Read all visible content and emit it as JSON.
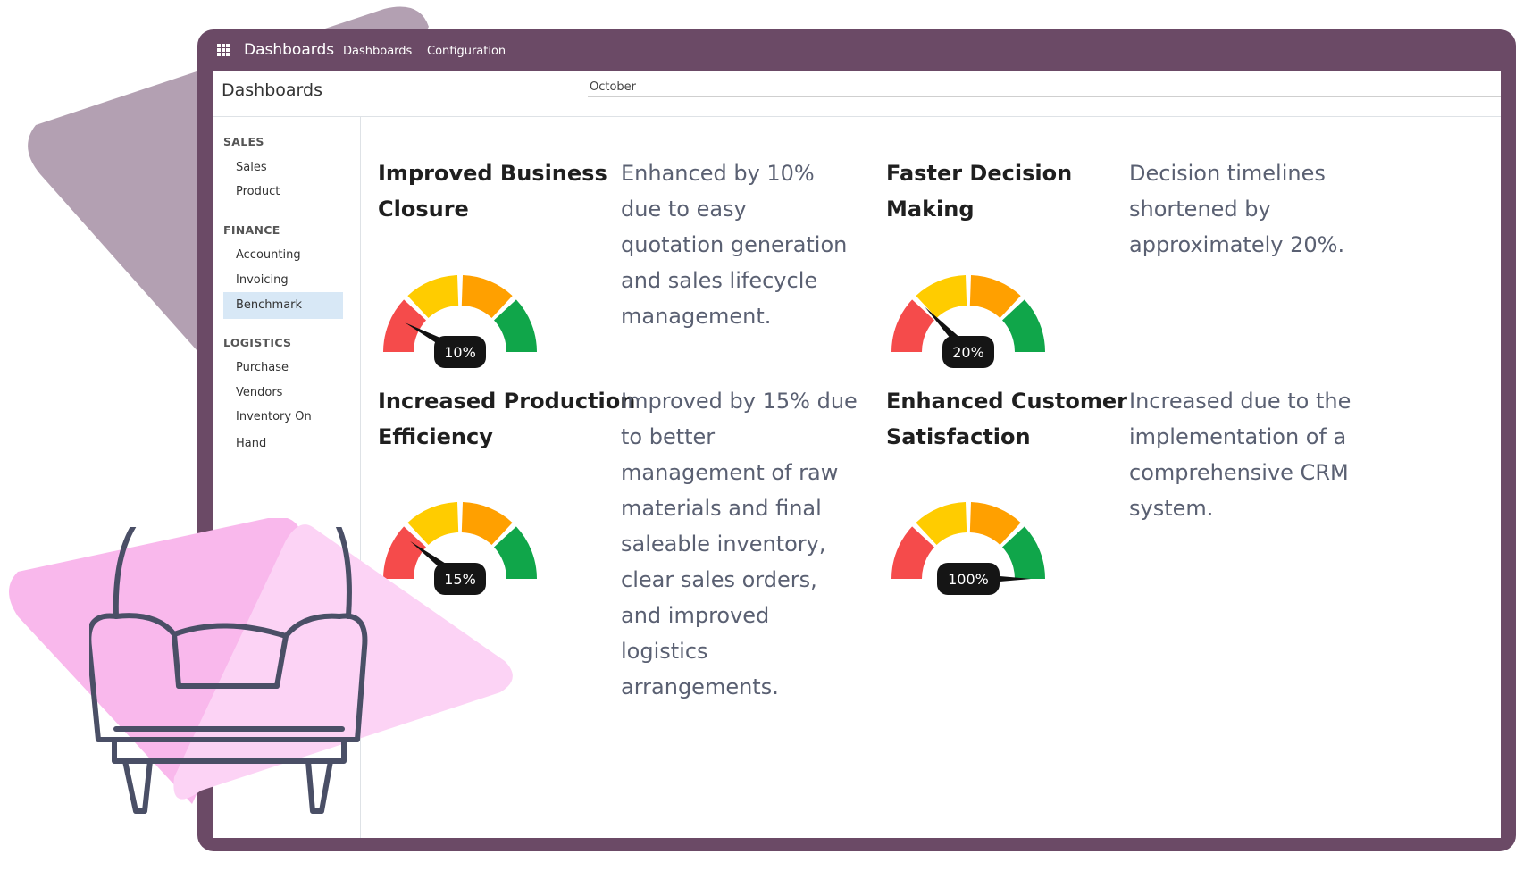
{
  "colors": {
    "frame": "#6b4a66",
    "deco_mauve": "#b3a0b2",
    "deco_pink": "#f9b8ec",
    "gauge_red": "#f54b4b",
    "gauge_yellow": "#ffcc00",
    "gauge_orange": "#ffa000",
    "gauge_green": "#10a64a",
    "active_item": "#d8e8f6"
  },
  "topbar": {
    "app_icon": "grid-icon",
    "brand": "Dashboards",
    "menu": [
      "Dashboards",
      "Configuration"
    ]
  },
  "control": {
    "title": "Dashboards",
    "period": "October"
  },
  "sidebar": {
    "groups": [
      {
        "label": "SALES",
        "items": [
          "Sales",
          "Product"
        ]
      },
      {
        "label": "FINANCE",
        "items": [
          "Accounting",
          "Invoicing",
          "Benchmark"
        ]
      },
      {
        "label": "LOGISTICS",
        "items": [
          "Purchase",
          "Vendors",
          "Inventory On Hand"
        ]
      }
    ],
    "active": "Benchmark"
  },
  "cards": [
    {
      "title": [
        "Improved Business",
        "Closure"
      ],
      "gauge_value": 10,
      "gauge_label": "10%",
      "desc": [
        "Enhanced by 10%",
        "due to easy",
        "quotation generation",
        "and sales lifecycle",
        "management."
      ]
    },
    {
      "title": [
        "Faster Decision",
        "Making"
      ],
      "gauge_value": 20,
      "gauge_label": "20%",
      "desc": [
        "Decision timelines",
        "shortened by",
        "approximately 20%."
      ]
    },
    {
      "title": [
        "Increased Production",
        "Efficiency"
      ],
      "gauge_value": 15,
      "gauge_label": "15%",
      "desc": [
        "Improved by 15% due",
        "to better",
        "management of raw",
        "materials and final",
        "saleable inventory,",
        "clear sales orders,",
        "and improved",
        "logistics",
        "arrangements."
      ]
    },
    {
      "title": [
        "Enhanced Customer",
        "Satisfaction"
      ],
      "gauge_value": 100,
      "gauge_label": "100%",
      "desc": [
        "Increased due to the",
        "implementation of a",
        "comprehensive CRM",
        "system."
      ]
    }
  ]
}
